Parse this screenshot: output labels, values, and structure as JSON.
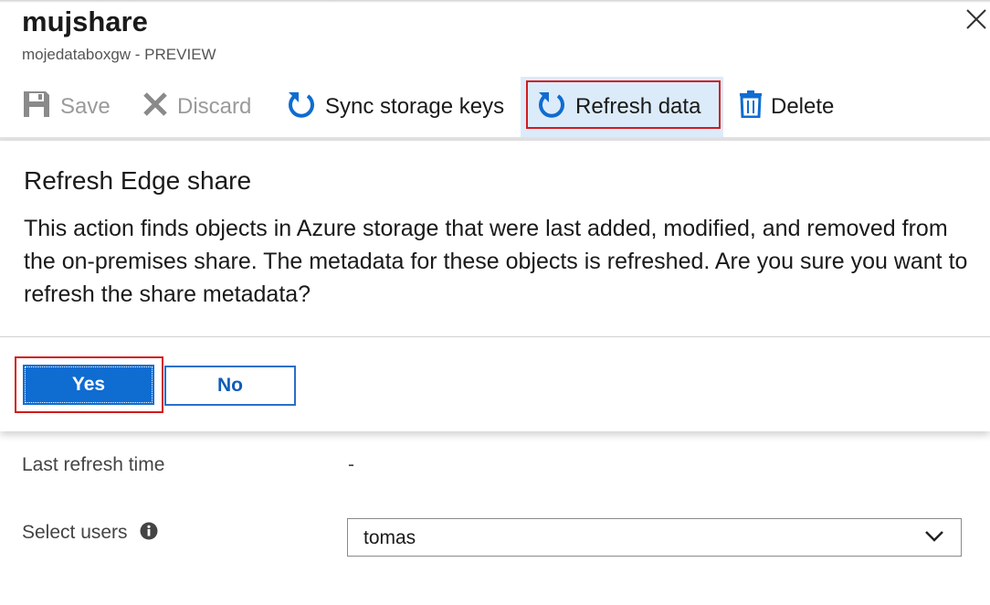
{
  "blade": {
    "title": "mujshare",
    "subtitle": "mojedataboxgw - PREVIEW"
  },
  "toolbar": {
    "save_label": "Save",
    "discard_label": "Discard",
    "sync_label": "Sync storage keys",
    "refresh_label": "Refresh data",
    "delete_label": "Delete"
  },
  "dialog": {
    "title": "Refresh Edge share",
    "message": "This action finds objects in Azure storage that were last added, modified, and removed from the on-premises share. The metadata for these objects is refreshed. Are you sure you want to refresh the share metadata?",
    "yes_label": "Yes",
    "no_label": "No"
  },
  "properties": {
    "last_refresh_label": "Last refresh time",
    "last_refresh_value": "-",
    "select_users_label": "Select users",
    "select_users_value": "tomas"
  },
  "colors": {
    "accent": "#0f6cd1",
    "highlight": "#d21b1b",
    "active_bg": "#dcebfa"
  },
  "icons": [
    "save-icon",
    "discard-icon",
    "sync-icon",
    "refresh-icon",
    "delete-icon",
    "close-icon",
    "info-icon",
    "chevron-down-icon"
  ]
}
